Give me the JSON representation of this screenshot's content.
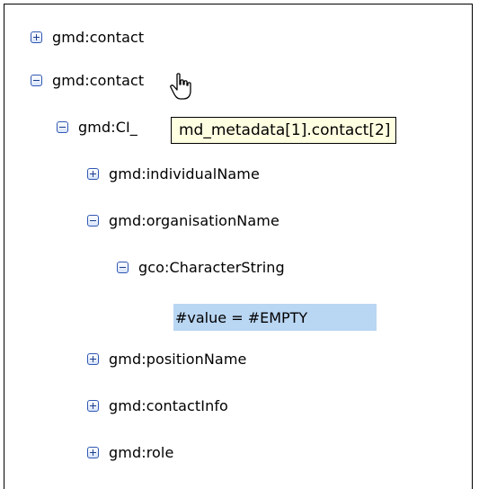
{
  "tree": {
    "nodes": [
      {
        "label": "gmd:contact",
        "state": "collapsed"
      },
      {
        "label": "gmd:contact",
        "state": "expanded"
      },
      {
        "label": "gmd:CI_",
        "state": "expanded"
      },
      {
        "label": "gmd:individualName",
        "state": "collapsed"
      },
      {
        "label": "gmd:organisationName",
        "state": "expanded"
      },
      {
        "label": "gco:CharacterString",
        "state": "expanded"
      },
      {
        "label": "gmd:positionName",
        "state": "collapsed"
      },
      {
        "label": "gmd:contactInfo",
        "state": "collapsed"
      },
      {
        "label": "gmd:role",
        "state": "collapsed"
      }
    ],
    "selected_value": "#value = #EMPTY"
  },
  "tooltip": {
    "text": "md_metadata[1].contact[2]"
  },
  "icons": {
    "collapsed": "expand-plus-icon",
    "expanded": "collapse-minus-icon",
    "cursor": "hand-pointer-icon"
  },
  "colors": {
    "selection": "#b9d6f3",
    "tooltip_bg": "#ffffe1",
    "toggle_border": "#2f57b3"
  }
}
